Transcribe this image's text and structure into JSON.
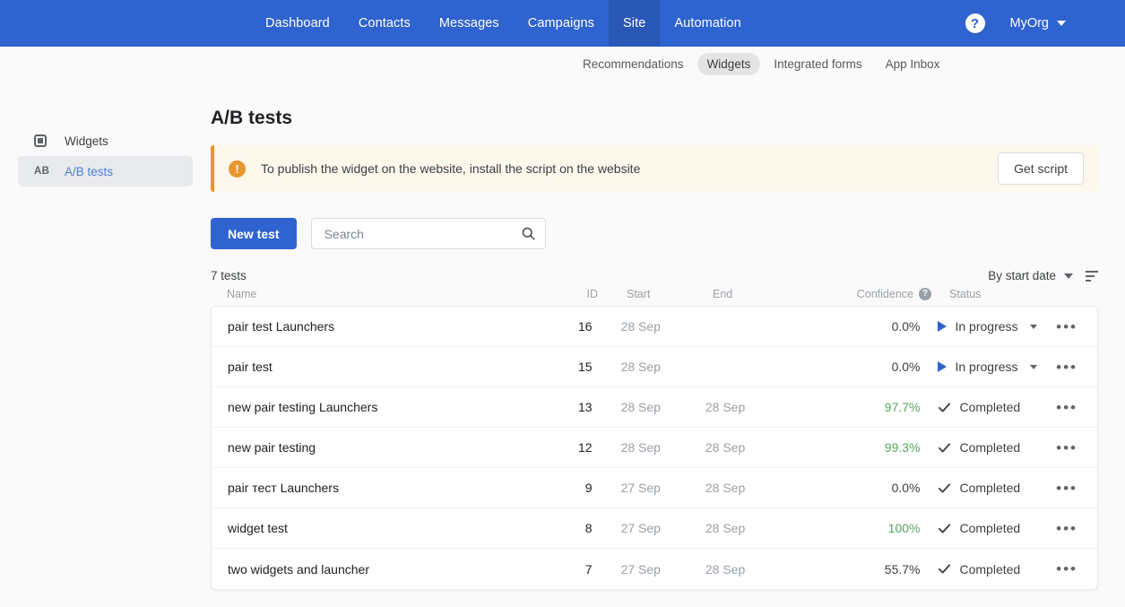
{
  "topnav": {
    "items": [
      {
        "label": "Dashboard",
        "active": false
      },
      {
        "label": "Contacts",
        "active": false
      },
      {
        "label": "Messages",
        "active": false
      },
      {
        "label": "Campaigns",
        "active": false
      },
      {
        "label": "Site",
        "active": true
      },
      {
        "label": "Automation",
        "active": false
      }
    ],
    "help_glyph": "?",
    "org_name": "MyOrg",
    "brand_color": "#2f63cf",
    "active_tab_color": "#2a58b8"
  },
  "subnav": {
    "items": [
      {
        "label": "Recommendations",
        "active": false
      },
      {
        "label": "Widgets",
        "active": true
      },
      {
        "label": "Integrated forms",
        "active": false
      },
      {
        "label": "App Inbox",
        "active": false
      }
    ]
  },
  "sidebar": {
    "items": [
      {
        "label": "Widgets",
        "icon": "widget-square-icon",
        "badge": "",
        "active": false
      },
      {
        "label": "A/B tests",
        "icon": "ab-text-icon",
        "badge": "AB",
        "active": true
      }
    ]
  },
  "page": {
    "title": "A/B tests"
  },
  "alert": {
    "icon_glyph": "!",
    "message": "To publish the widget on the website, install the script on the website",
    "button_label": "Get script",
    "accent_color": "#e8962e",
    "background_color": "#fdf7ec"
  },
  "toolbar": {
    "new_test_label": "New test",
    "search_placeholder": "Search",
    "search_value": ""
  },
  "list": {
    "count_label": "7 tests",
    "sort_label": "By start date",
    "sort_icon": "sort-lines-icon"
  },
  "table": {
    "headers": {
      "name": "Name",
      "id": "ID",
      "start": "Start",
      "end": "End",
      "confidence": "Confidence",
      "confidence_help_glyph": "?",
      "status": "Status"
    },
    "rows": [
      {
        "name": "pair test Launchers",
        "id": "16",
        "start": "28 Sep",
        "end": "",
        "confidence": "0.0%",
        "confidence_high": false,
        "status": "In progress",
        "status_type": "in-progress"
      },
      {
        "name": "pair test",
        "id": "15",
        "start": "28 Sep",
        "end": "",
        "confidence": "0.0%",
        "confidence_high": false,
        "status": "In progress",
        "status_type": "in-progress"
      },
      {
        "name": "new pair testing Launchers",
        "id": "13",
        "start": "28 Sep",
        "end": "28 Sep",
        "confidence": "97.7%",
        "confidence_high": true,
        "status": "Completed",
        "status_type": "completed"
      },
      {
        "name": "new pair testing",
        "id": "12",
        "start": "28 Sep",
        "end": "28 Sep",
        "confidence": "99.3%",
        "confidence_high": true,
        "status": "Completed",
        "status_type": "completed"
      },
      {
        "name": "pair тест Launchers",
        "id": "9",
        "start": "27 Sep",
        "end": "28 Sep",
        "confidence": "0.0%",
        "confidence_high": false,
        "status": "Completed",
        "status_type": "completed"
      },
      {
        "name": "widget test",
        "id": "8",
        "start": "27 Sep",
        "end": "28 Sep",
        "confidence": "100%",
        "confidence_high": true,
        "status": "Completed",
        "status_type": "completed"
      },
      {
        "name": "two widgets and launcher",
        "id": "7",
        "start": "27 Sep",
        "end": "28 Sep",
        "confidence": "55.7%",
        "confidence_high": false,
        "status": "Completed",
        "status_type": "completed"
      }
    ],
    "row_menu_glyph": "•••",
    "confidence_high_color": "#5aa55f"
  }
}
